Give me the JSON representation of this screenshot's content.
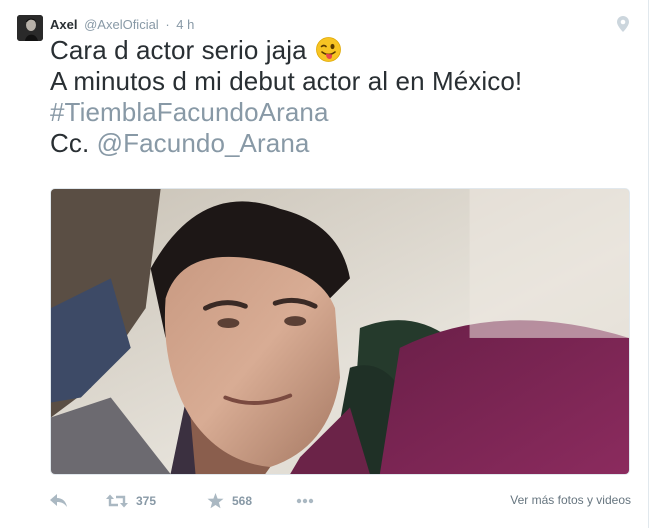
{
  "author": {
    "name": "Axel",
    "handle": "@AxelOficial",
    "separator": "·",
    "time": "4 h"
  },
  "tweet": {
    "line1": "Cara d actor serio jaja",
    "line2": "A minutos d mi debut actor al en México!",
    "hashtag": "#TiemblaFacundoArana",
    "cc_prefix": "Cc. ",
    "mention": "@Facundo_Arana"
  },
  "icons": {
    "geo": "location-pin-icon",
    "emoji": "winking-face-with-tongue-icon",
    "reply": "reply-arrow-icon",
    "retweet": "retweet-icon",
    "favorite": "star-icon",
    "more": "more-dots-icon"
  },
  "actions": {
    "retweet_count": "375",
    "favorite_count": "568",
    "see_more_label": "Ver más fotos y videos"
  },
  "colors": {
    "text": "#292f33",
    "muted": "#8899a6",
    "link_muted": "#8899a6",
    "border": "#e1e8ed"
  }
}
